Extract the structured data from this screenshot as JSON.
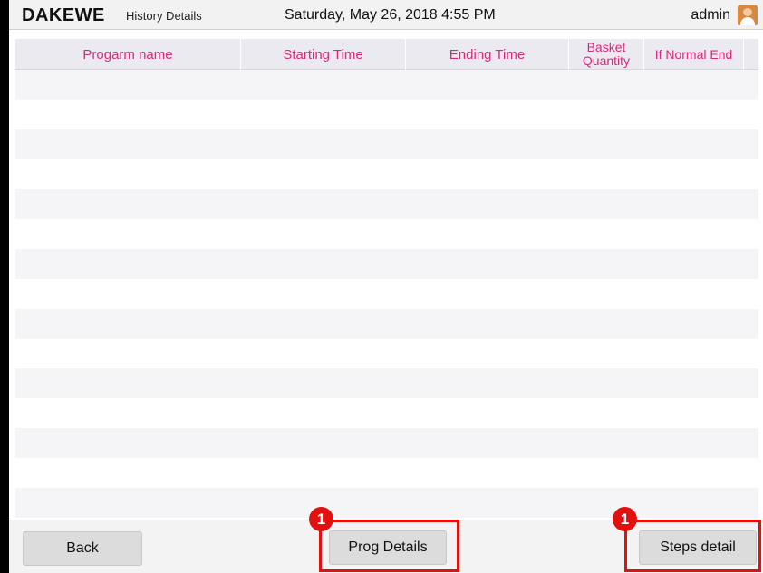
{
  "header": {
    "brand": "DAKEWE",
    "screen_title": "History Details",
    "datetime": "Saturday, May 26, 2018  4:55 PM",
    "user": "admin",
    "avatar_icon": "user-avatar-icon"
  },
  "table": {
    "columns": [
      "Progarm name",
      "Starting Time",
      "Ending Time",
      "Basket Quantity",
      "If Normal  End",
      ""
    ],
    "rows": [],
    "header_color": "#e0267a"
  },
  "footer": {
    "back_label": "Back",
    "prog_details_label": "Prog Details",
    "steps_detail_label": "Steps detail"
  },
  "annotations": {
    "prog_marker": "1",
    "steps_marker": "1",
    "highlight_color": "#e31010"
  }
}
